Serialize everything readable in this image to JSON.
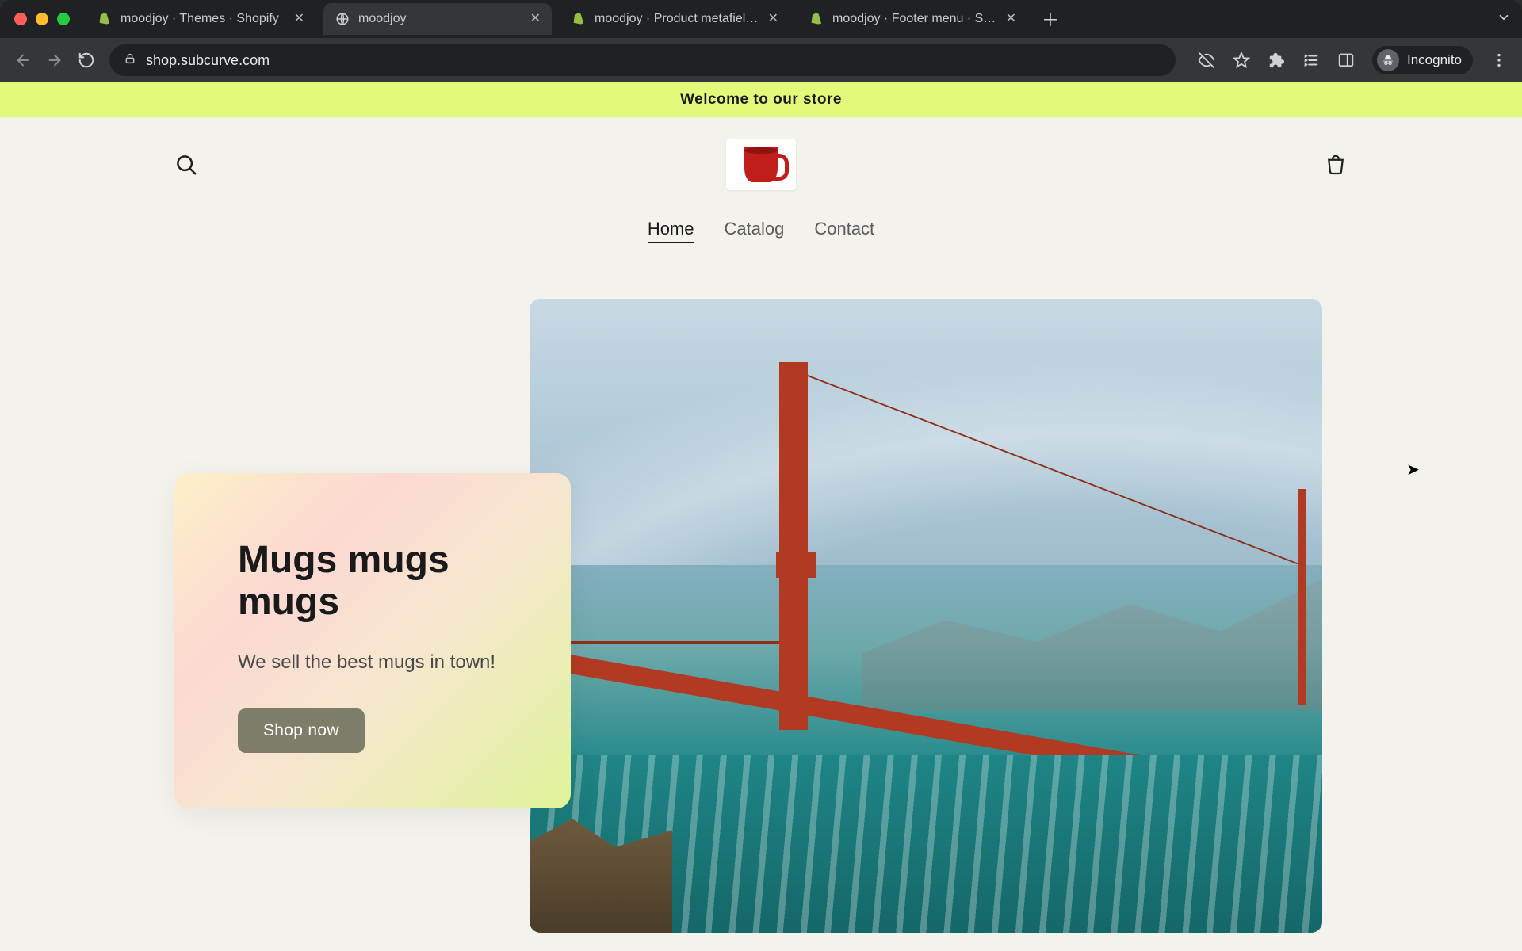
{
  "browser": {
    "tabs": [
      {
        "title": "moodjoy · Themes · Shopify",
        "icon": "shopify"
      },
      {
        "title": "moodjoy",
        "icon": "globe"
      },
      {
        "title": "moodjoy · Product metafield d",
        "icon": "shopify"
      },
      {
        "title": "moodjoy · Footer menu · Shop",
        "icon": "shopify"
      }
    ],
    "active_tab_index": 1,
    "url": "shop.subcurve.com",
    "incognito_label": "Incognito"
  },
  "announcement": "Welcome to our store",
  "nav": {
    "items": [
      "Home",
      "Catalog",
      "Contact"
    ],
    "active_index": 0
  },
  "hero": {
    "title": "Mugs mugs mugs",
    "subtitle": "We sell the best mugs in town!",
    "button": "Shop now",
    "image_alt": "Golden Gate Bridge"
  },
  "colors": {
    "announcement_bg": "#e3f97a",
    "page_bg": "#f3f2ec",
    "accent": "#b23a22",
    "button_bg": "#7d7d6a"
  }
}
